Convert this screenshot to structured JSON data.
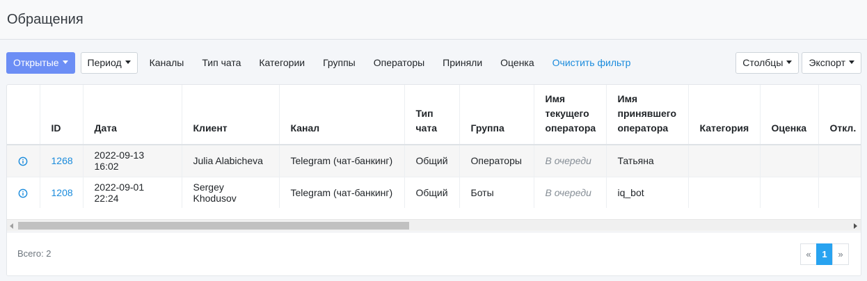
{
  "page": {
    "title": "Обращения"
  },
  "toolbar": {
    "status_button": "Открытые",
    "period_button": "Период",
    "filters": [
      "Каналы",
      "Тип чата",
      "Категории",
      "Группы",
      "Операторы",
      "Приняли",
      "Оценка"
    ],
    "clear_filter": "Очистить фильтр",
    "columns_button": "Столбцы",
    "export_button": "Экспорт"
  },
  "table": {
    "headers": {
      "id": "ID",
      "date": "Дата",
      "client": "Клиент",
      "channel": "Канал",
      "chat_type": "Тип чата",
      "group": "Группа",
      "current_operator": "Имя текущего оператора",
      "accepted_operator": "Имя принявшего оператора",
      "category": "Категория",
      "rating": "Оценка",
      "rejected": "Откл."
    },
    "rows": [
      {
        "id": "1268",
        "date": "2022-09-13 16:02",
        "client": "Julia Alabicheva",
        "channel": "Telegram (чат-банкинг)",
        "chat_type": "Общий",
        "group": "Операторы",
        "current_operator": "В очереди",
        "accepted_operator": "Татьяна"
      },
      {
        "id": "1208",
        "date": "2022-09-01 22:24",
        "client": "Sergey Khodusov",
        "channel": "Telegram (чат-банкинг)",
        "chat_type": "Общий",
        "group": "Боты",
        "current_operator": "В очереди",
        "accepted_operator": "iq_bot"
      }
    ]
  },
  "footer": {
    "total": "Всего: 2",
    "pager": {
      "prev": "«",
      "current": "1",
      "next": "»"
    }
  },
  "colors": {
    "primary": "#6c8ef5",
    "link": "#1a8bdc",
    "active_page": "#28a3f0"
  },
  "icons": {
    "row_info": "info-circle-icon"
  }
}
